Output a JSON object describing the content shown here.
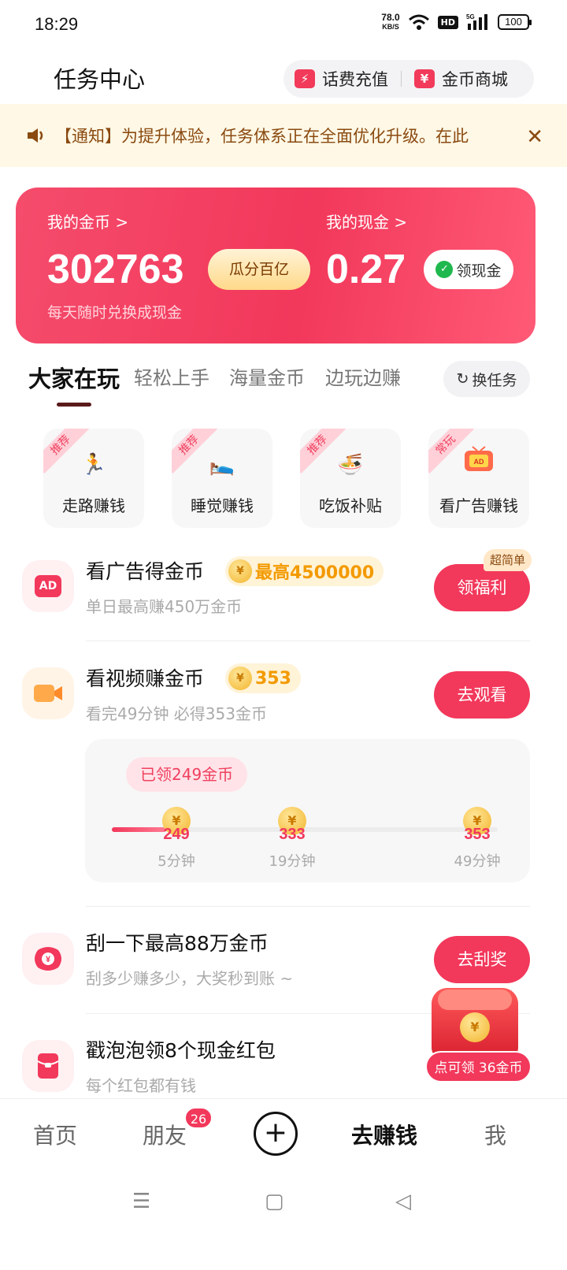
{
  "status_bar": {
    "time": "18:29",
    "net_speed": "78.0",
    "net_unit": "KB/S",
    "hd": "HD",
    "signal": "5G",
    "battery": "100"
  },
  "header": {
    "title": "任务中心",
    "recharge_label": "话费充值",
    "mall_label": "金币商城"
  },
  "notice": {
    "text": "【通知】为提升体验，任务体系正在全面优化升级。在此"
  },
  "wallet": {
    "coins_label": "我的金币 >",
    "coins_value": "302763",
    "split_label": "瓜分百亿",
    "cash_label": "我的现金 >",
    "cash_value": "0.27",
    "withdraw_label": "领现金",
    "hint": "每天随时兑换成现金"
  },
  "tabs": {
    "items": [
      "大家在玩",
      "轻松上手",
      "海量金币",
      "边玩边赚"
    ],
    "refresh_label": "换任务"
  },
  "games": [
    {
      "tag": "推荐",
      "label": "走路赚钱",
      "icon": "running-man-icon"
    },
    {
      "tag": "推荐",
      "label": "睡觉赚钱",
      "icon": "sleeping-icon"
    },
    {
      "tag": "推荐",
      "label": "吃饭补贴",
      "icon": "noodle-bowl-icon"
    },
    {
      "tag": "常玩",
      "label": "看广告赚钱",
      "icon": "tv-ad-icon"
    }
  ],
  "tasks": {
    "ad": {
      "title": "看广告得金币",
      "badge": "最高4500000",
      "sub": "单日最高赚450万金币",
      "button": "领福利",
      "tag": "超简单"
    },
    "video": {
      "title": "看视频赚金币",
      "badge": "353",
      "sub": "看完49分钟 必得353金币",
      "button": "去观看",
      "received": "已领249金币",
      "progress": 0.14,
      "milestones": [
        {
          "value": "249",
          "time": "5分钟"
        },
        {
          "value": "333",
          "time": "19分钟"
        },
        {
          "value": "353",
          "time": "49分钟"
        }
      ]
    },
    "scratch": {
      "title": "刮一下最高88万金币",
      "sub": "刮多少赚多少，大奖秒到账 ~",
      "button": "去刮奖"
    },
    "bubble": {
      "title": "戳泡泡领8个现金红包",
      "sub": "每个红包都有钱"
    }
  },
  "floating": {
    "label": "点可领 36金币"
  },
  "bottom_nav": {
    "home": "首页",
    "friends": "朋友",
    "friends_badge": "26",
    "earn": "去赚钱",
    "me": "我"
  },
  "colors": {
    "accent": "#f2385b",
    "coin": "#f39a00",
    "notice_bg": "#fff8e6"
  }
}
